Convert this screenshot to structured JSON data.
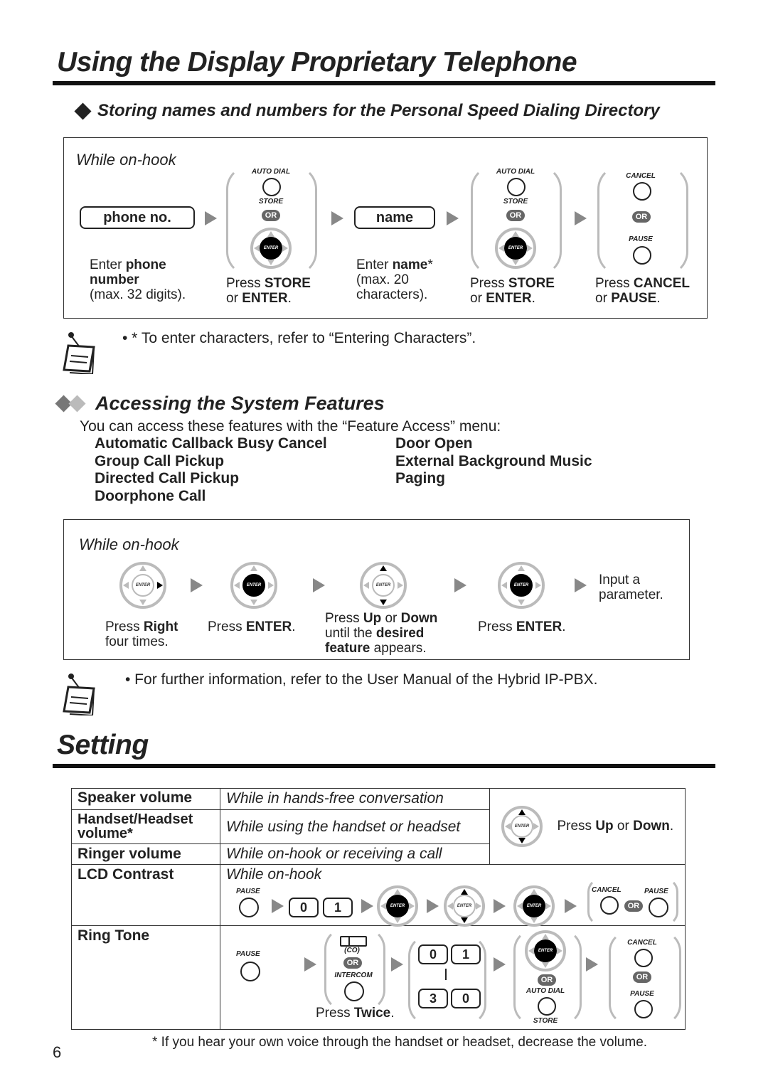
{
  "page": {
    "title": "Using the Display Proprietary Telephone",
    "page_number": "6"
  },
  "section_speed_dial": {
    "heading": "Storing names and numbers for the Personal Speed Dialing Directory",
    "condition": "While on-hook",
    "fields": {
      "phone": "phone no.",
      "name": "name"
    },
    "buttons": {
      "auto_dial": "AUTO DIAL",
      "store": "STORE",
      "or": "OR",
      "enter": "ENTER",
      "cancel": "CANCEL",
      "pause": "PAUSE"
    },
    "steps": [
      {
        "pre": "Enter ",
        "bold": "phone number",
        "post": "",
        "extra": "(max. 32 digits)."
      },
      {
        "pre": "Press ",
        "bold": "STORE",
        "line2_pre": "or ",
        "line2_bold": "ENTER",
        "line2_post": "."
      },
      {
        "pre": "Enter ",
        "bold": "name",
        "post": "*",
        "extra": "(max. 20 characters)."
      },
      {
        "pre": "Press ",
        "bold": "STORE",
        "line2_pre": "or ",
        "line2_bold": "ENTER",
        "line2_post": "."
      },
      {
        "pre": "Press ",
        "bold": "CANCEL",
        "line2_pre": "or ",
        "line2_bold": "PAUSE",
        "line2_post": "."
      }
    ],
    "note": "• * To enter characters, refer to “Entering Characters”."
  },
  "section_features": {
    "heading": "Accessing the System Features",
    "intro": "You can access these features with the “Feature Access” menu:",
    "features_col1": [
      "Automatic Callback Busy Cancel",
      "Group Call Pickup",
      "Directed Call Pickup",
      "Doorphone Call"
    ],
    "features_col2": [
      "Door Open",
      "External Background Music",
      "Paging"
    ],
    "condition": "While on-hook",
    "steps": [
      {
        "pre": "Press ",
        "bold": "Right",
        "post": "",
        "line2": "four times."
      },
      {
        "pre": "Press ",
        "bold": "ENTER",
        "post": "."
      },
      {
        "pre": "Press ",
        "bold": "Up",
        "mid": " or ",
        "bold2": "Down",
        "line2_pre": "until the ",
        "line2_bold": "desired",
        "line3_bold": "feature",
        "line3_post": " appears."
      },
      {
        "pre": "Press ",
        "bold": "ENTER",
        "post": "."
      },
      {
        "text": "Input a parameter."
      }
    ],
    "note": "• For further information, refer to the User Manual of the Hybrid IP-PBX."
  },
  "section_setting": {
    "heading": "Setting",
    "rows": [
      {
        "label": "Speaker volume",
        "condition": "While in hands-free conversation"
      },
      {
        "label": "Handset/Headset volume*",
        "condition": "While using the handset or headset"
      },
      {
        "label": "Ringer volume",
        "condition": "While on-hook or receiving a call"
      },
      {
        "label": "LCD Contrast",
        "condition": "While on-hook"
      },
      {
        "label": "Ring Tone",
        "condition": ""
      }
    ],
    "volume_action": {
      "pre": "Press ",
      "bold": "Up",
      "mid": " or ",
      "bold2": "Down",
      "post": "."
    },
    "keys": {
      "k0": "0",
      "k1": "1",
      "k3": "3",
      "co": "(CO)",
      "intercom": "INTERCOM"
    },
    "ring_tone_press": {
      "pre": "Press ",
      "bold": "Twice",
      "post": "."
    },
    "footnote": "* If you hear your own voice through the handset or headset, decrease the volume."
  }
}
